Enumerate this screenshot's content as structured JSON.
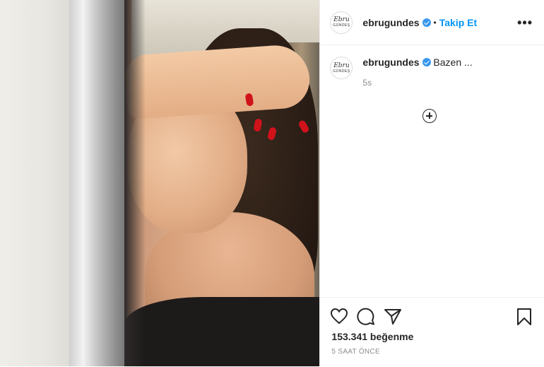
{
  "header": {
    "avatar_line1": "Ebru",
    "avatar_line2": "GÜNDEŞ",
    "username": "ebrugundes",
    "separator": "•",
    "follow_label": "Takip Et",
    "more_label": "•••"
  },
  "caption": {
    "username": "ebrugundes",
    "text": "Bazen ...",
    "age": "5s"
  },
  "actions": {
    "likes": "153.341 beğenme",
    "posted": "5 SAAT ÖNCE"
  },
  "icons": [
    "heart-icon",
    "comment-icon",
    "share-icon",
    "bookmark-icon",
    "add-icon",
    "verified-badge-icon"
  ],
  "colors": {
    "link": "#0095f6",
    "verified": "#3897f0",
    "nail": "#d0121b"
  }
}
